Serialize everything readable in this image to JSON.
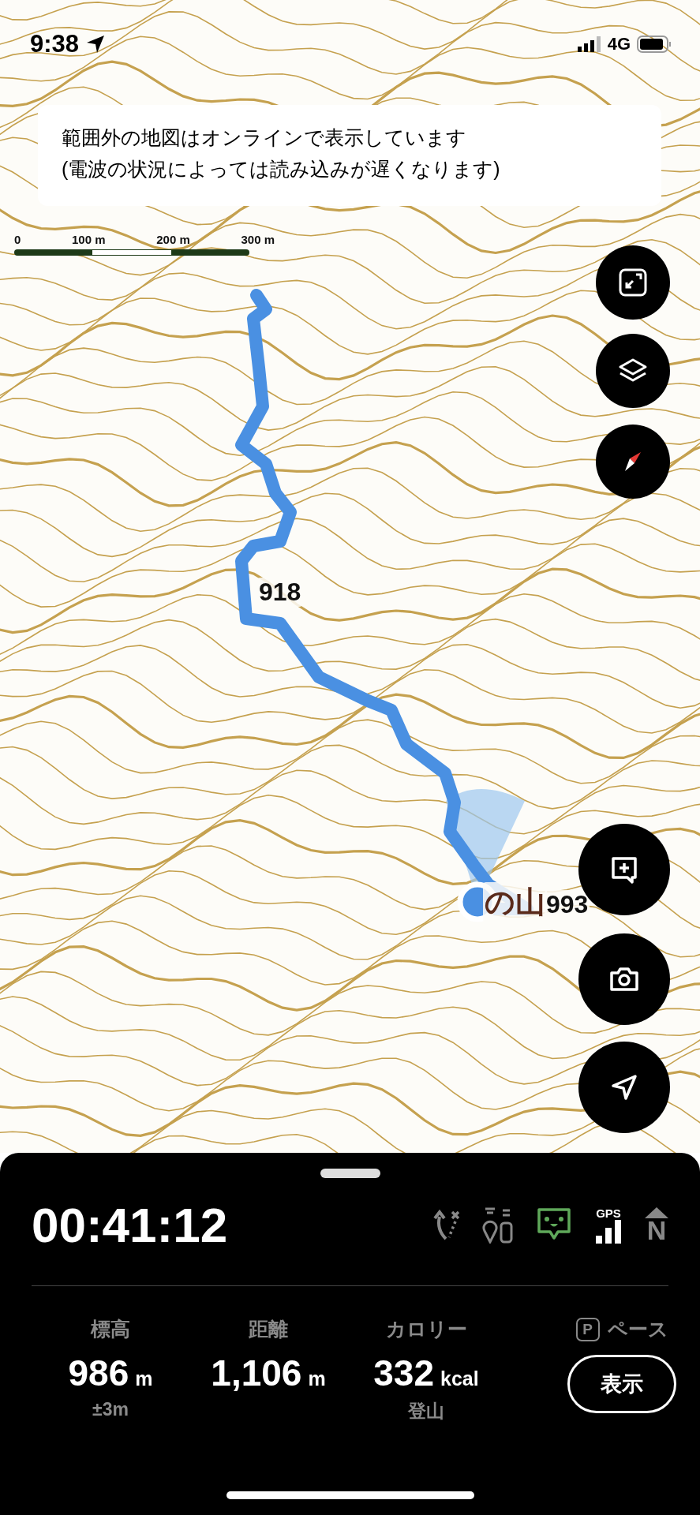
{
  "status_bar": {
    "time": "9:38",
    "network": "4G"
  },
  "banner": {
    "lines": [
      "範囲外の地図はオンラインで表示しています",
      "(電波の状況によっては読み込みが遅くなります)"
    ]
  },
  "scale_bar": {
    "labels": [
      "0",
      "100 m",
      "200 m",
      "300 m"
    ]
  },
  "map": {
    "labels": [
      {
        "text": "918",
        "kind": "elevation"
      },
      {
        "text": "の山",
        "kind": "peak"
      },
      {
        "text": "993",
        "kind": "elevation"
      }
    ]
  },
  "map_buttons": [
    {
      "kind": "fit"
    },
    {
      "kind": "layers"
    },
    {
      "kind": "compass"
    },
    {
      "kind": "memo"
    },
    {
      "kind": "camera"
    },
    {
      "kind": "locate"
    }
  ],
  "panel": {
    "timer": "00:41:12",
    "indicators": [
      {
        "kind": "route",
        "active": false
      },
      {
        "kind": "markers",
        "active": false
      },
      {
        "kind": "face",
        "active": true
      },
      {
        "kind": "gps",
        "text": "GPS",
        "active": true
      },
      {
        "kind": "north",
        "text": "N",
        "active": false
      }
    ],
    "stats": [
      {
        "label": "標高",
        "value": "986",
        "unit": "m",
        "sub": "±3m"
      },
      {
        "label": "距離",
        "value": "1,106",
        "unit": "m"
      },
      {
        "label": "カロリー",
        "value": "332",
        "unit": "kcal",
        "sub": "登山"
      }
    ],
    "pace": {
      "badge": "P",
      "label": "ペース",
      "button": "表示"
    }
  }
}
